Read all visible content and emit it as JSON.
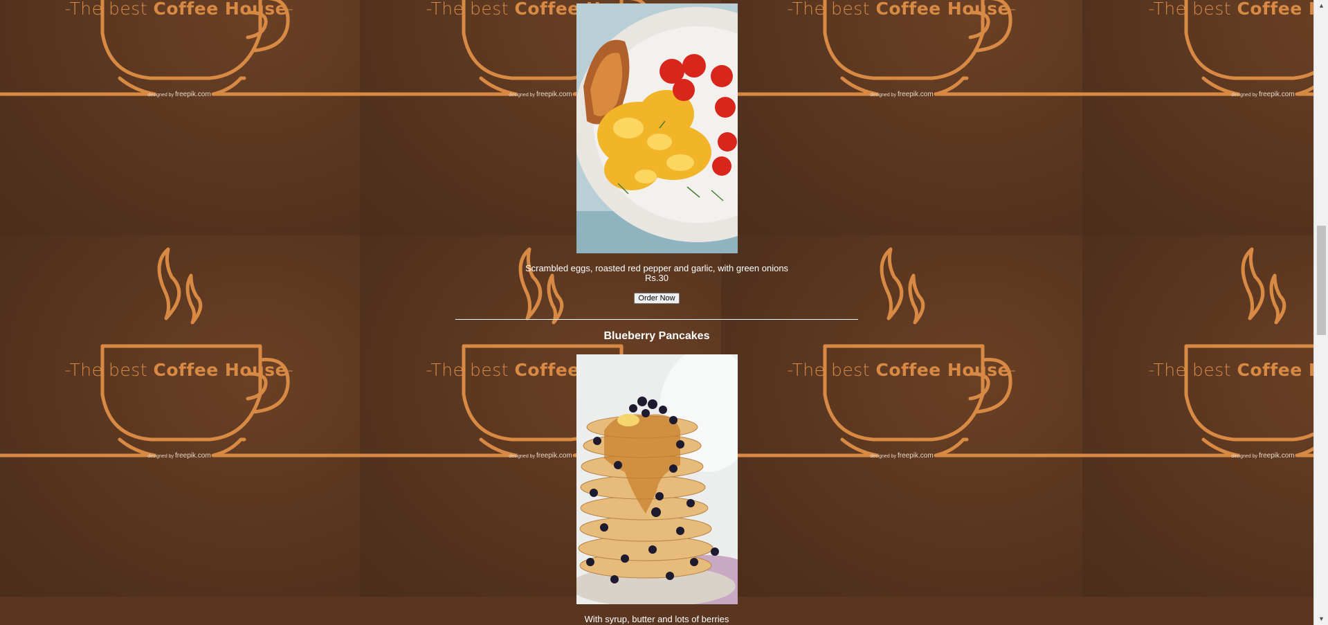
{
  "background": {
    "tagline_prefix": "-The best ",
    "tagline_bold": "Coffee House",
    "tagline_suffix": "-",
    "credit_small": "designed by",
    "credit": "freepik.com",
    "accent_color": "#d88a45",
    "base_color": "#5a3620"
  },
  "items": [
    {
      "description": "Scrambled eggs, roasted red pepper and garlic, with green onions",
      "price": "Rs.30",
      "button_label": "Order Now"
    },
    {
      "title": "Blueberry Pancakes",
      "description": "With syrup, butter and lots of berries"
    }
  ],
  "scrollbar": {
    "up_icon": "▲",
    "down_icon": "▼"
  }
}
